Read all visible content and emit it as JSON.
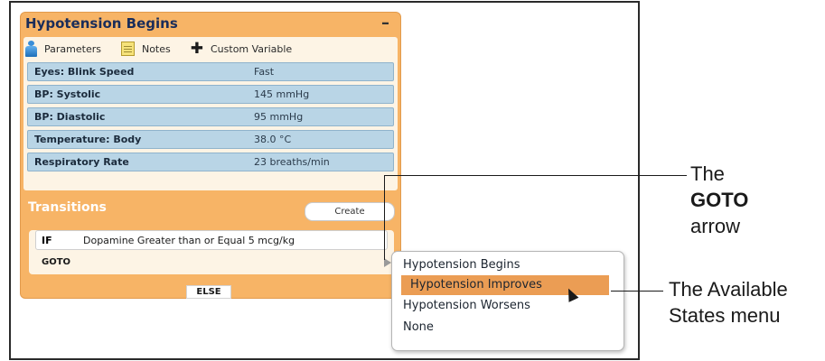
{
  "panel": {
    "title": "Hypotension Begins",
    "collapse": "–",
    "toolbar": [
      {
        "label": "Parameters",
        "icon": "parameters-icon"
      },
      {
        "label": "Notes",
        "icon": "notes-icon"
      },
      {
        "label": "Custom Variable",
        "icon": "plus-icon"
      }
    ],
    "parameters": [
      {
        "name": "Eyes: Blink Speed",
        "value": "Fast"
      },
      {
        "name": "BP: Systolic",
        "value": "145 mmHg"
      },
      {
        "name": "BP: Diastolic",
        "value": "95 mmHg"
      },
      {
        "name": "Temperature: Body",
        "value": "38.0 °C"
      },
      {
        "name": "Respiratory Rate",
        "value": "23 breaths/min"
      }
    ],
    "transitions_label": "Transitions",
    "create_label": "Create",
    "condition": {
      "if_kw": "IF",
      "text": "Dopamine Greater than or Equal 5 mcg/kg",
      "goto_kw": "GOTO"
    },
    "else_label": "ELSE"
  },
  "states_menu": {
    "items": [
      "Hypotension Begins",
      "Hypotension Improves",
      "Hypotension Worsens",
      "None"
    ],
    "highlighted": "Hypotension Improves"
  },
  "annotations": {
    "goto": {
      "line1": "The",
      "line2": "GOTO",
      "line3": "arrow"
    },
    "menu": {
      "line1": "The Available",
      "line2": "States menu"
    }
  },
  "colors": {
    "panel": "#f7b466",
    "param_row": "#b9d5e6",
    "highlight": "#eb9d54",
    "title": "#1a2d5a"
  }
}
